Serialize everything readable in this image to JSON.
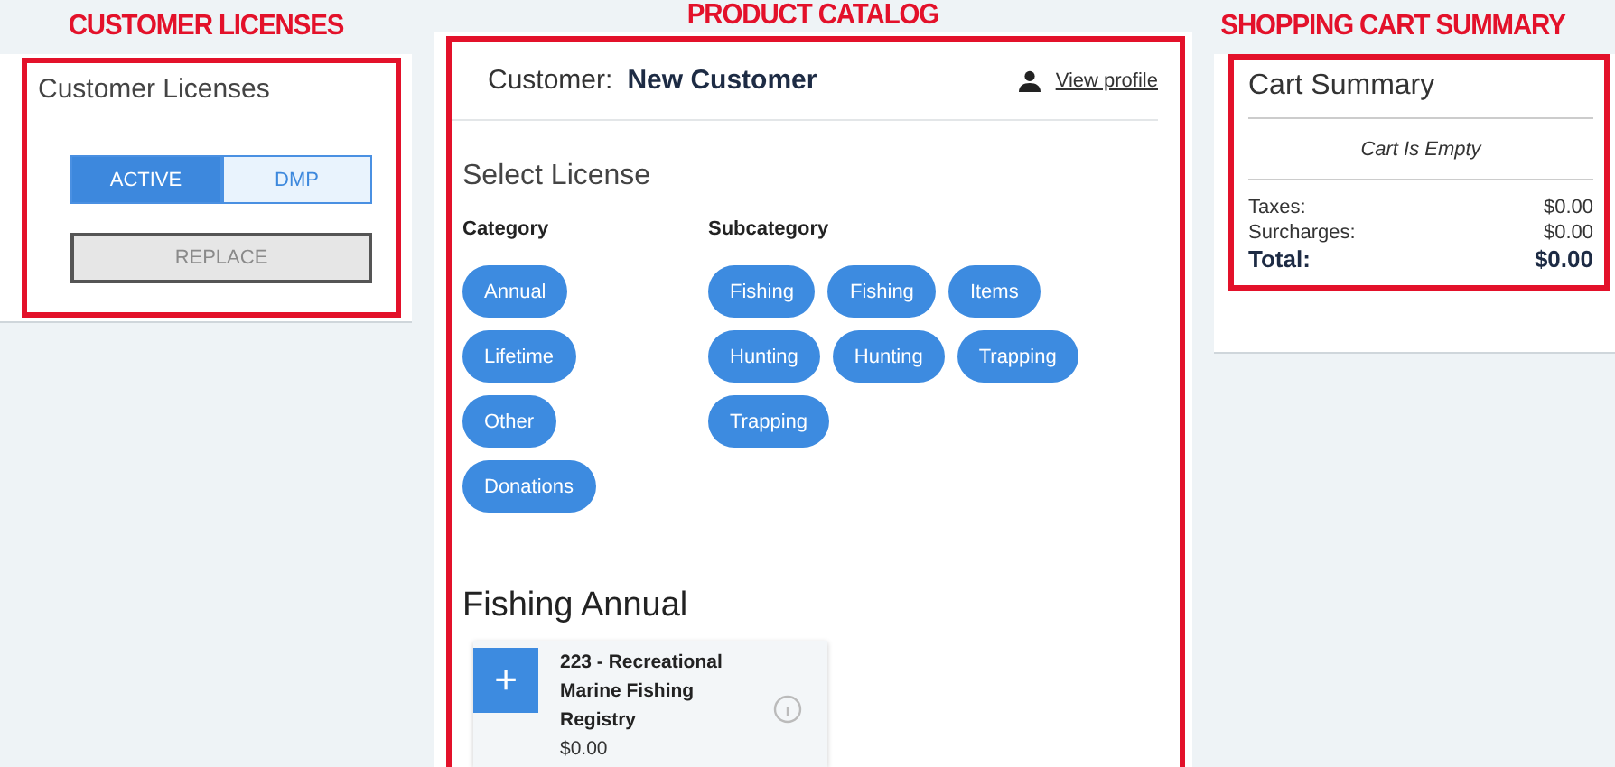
{
  "customer_licenses": {
    "annotation": "CUSTOMER LICENSES",
    "title": "Customer Licenses",
    "toggle": [
      {
        "label": "ACTIVE",
        "selected": true
      },
      {
        "label": "DMP",
        "selected": false
      }
    ],
    "replace_button": {
      "label": "REPLACE",
      "disabled": true
    }
  },
  "product_catalog": {
    "annotation": "PRODUCT CATALOG",
    "customer_label": "Customer:",
    "customer_name": "New Customer",
    "profile_link": "View profile",
    "section_title": "Select License",
    "category": {
      "heading": "Category",
      "chips": [
        "Annual",
        "Lifetime",
        "Other",
        "Donations"
      ]
    },
    "subcategory": {
      "heading": "Subcategory",
      "chips": [
        "Fishing",
        "Fishing",
        "Items",
        "Hunting",
        "Hunting",
        "Trapping",
        "Trapping"
      ]
    },
    "group_title": "Fishing Annual",
    "products": [
      {
        "name": "223 - Recreational Marine Fishing Registry",
        "price": "$0.00",
        "add_icon": "+"
      }
    ]
  },
  "shopping_cart_summary": {
    "annotation": "SHOPPING CART SUMMARY",
    "title": "Cart Summary",
    "empty_message": "Cart Is Empty",
    "lines": [
      {
        "label": "Taxes:",
        "amount": "$0.00",
        "kind": "line"
      },
      {
        "label": "Surcharges:",
        "amount": "$0.00",
        "kind": "line"
      },
      {
        "label": "Total:",
        "amount": "$0.00",
        "kind": "total"
      }
    ]
  }
}
